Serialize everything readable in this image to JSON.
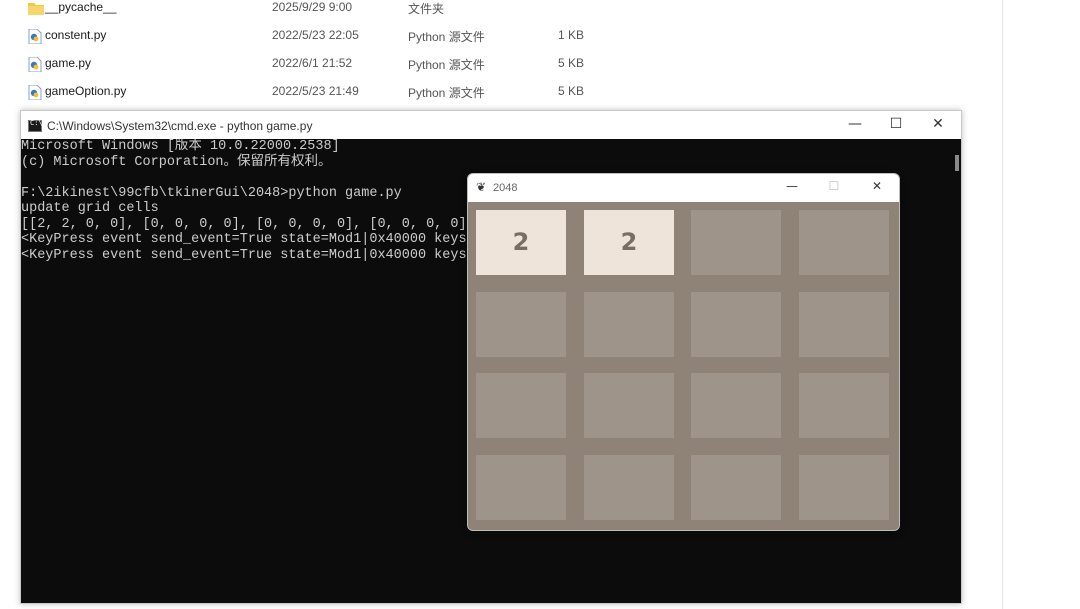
{
  "explorer": {
    "files": [
      {
        "name": "__pycache__",
        "date": "2025/9/29 9:00",
        "type": "文件夹",
        "size": "",
        "icon": "folder-icon"
      },
      {
        "name": "constent.py",
        "date": "2022/5/23 22:05",
        "type": "Python 源文件",
        "size": "1 KB",
        "icon": "python-file-icon"
      },
      {
        "name": "game.py",
        "date": "2022/6/1 21:52",
        "type": "Python 源文件",
        "size": "5 KB",
        "icon": "python-file-icon"
      },
      {
        "name": "gameOption.py",
        "date": "2022/5/23 21:49",
        "type": "Python 源文件",
        "size": "5 KB",
        "icon": "python-file-icon"
      }
    ]
  },
  "cmd": {
    "title": "C:\\Windows\\System32\\cmd.exe - python  game.py",
    "minimize": "—",
    "maximize": "☐",
    "close": "✕",
    "lines": [
      "Microsoft Windows [版本 10.0.22000.2538]",
      "(c) Microsoft Corporation。保留所有权利。",
      "",
      "F:\\2ikinest\\99cfb\\tkinerGui\\2048>python game.py",
      "update grid cells",
      "[[2, 2, 0, 0], [0, 0, 0, 0], [0, 0, 0, 0], [0, 0, 0, 0]]",
      "<KeyPress event send_event=True state=Mod1|0x40000 keysym=",
      "<KeyPress event send_event=True state=Mod1|0x40000 keysym="
    ]
  },
  "game": {
    "title": "2048",
    "minimize": "—",
    "maximize": "☐",
    "close": "✕",
    "grid": [
      [
        "2",
        "2",
        "",
        ""
      ],
      [
        "",
        "",
        "",
        ""
      ],
      [
        "",
        "",
        "",
        ""
      ],
      [
        "",
        "",
        "",
        ""
      ]
    ]
  },
  "colors": {
    "board": "#8f8276",
    "empty_tile": "#9f948a",
    "tile_2": "#eee4da",
    "tile_text": "#776e65",
    "console_bg": "#0c0c0c",
    "console_text": "#cccccc"
  }
}
